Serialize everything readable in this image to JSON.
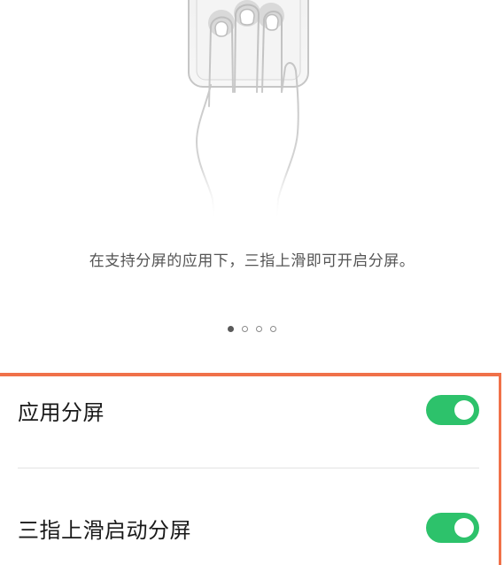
{
  "tutorial": {
    "caption": "在支持分屏的应用下，三指上滑即可开启分屏。",
    "page_count": 4,
    "current_page": 1
  },
  "settings": [
    {
      "label": "应用分屏",
      "enabled": true
    },
    {
      "label": "三指上滑启动分屏",
      "enabled": true
    }
  ],
  "colors": {
    "toggle_on": "#2dc26b",
    "highlight_border": "#f07149"
  },
  "icons": {
    "illustration": "three-finger-swipe-hand-icon"
  }
}
